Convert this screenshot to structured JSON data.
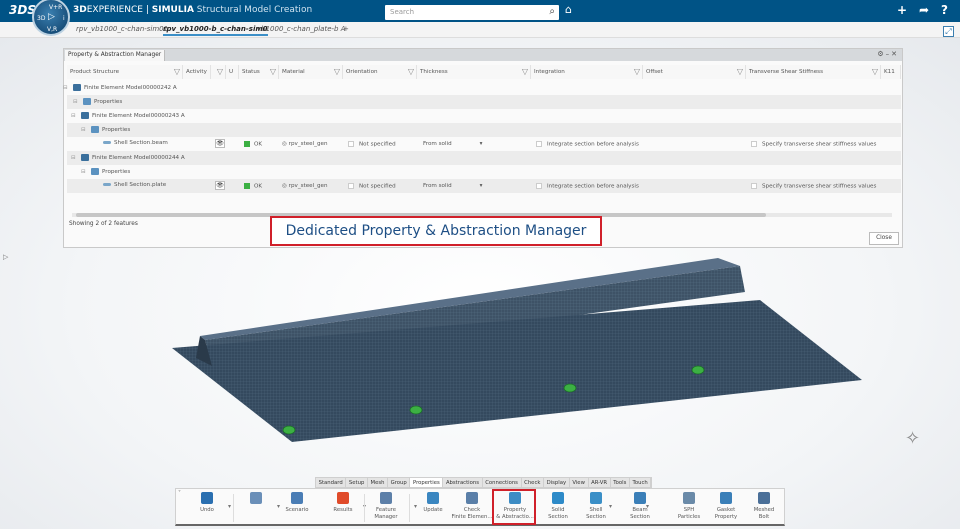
{
  "topbar": {
    "brand_bold": "3D",
    "brand_rest": "EXPERIENCE | ",
    "brand_app": "SIMULIA",
    "brand_title": " Structural Model Creation",
    "search_placeholder": "Search",
    "compass": {
      "top": "V+R",
      "left": "3D",
      "right": "i",
      "bottom": "V,R"
    }
  },
  "tabs": [
    {
      "label": "rpv_vb1000_c-chan-sim01"
    },
    {
      "label": "rpv_vb1000-b_c-chan-sim0",
      "active": true
    },
    {
      "label": "vb1000_c-chan_plate-b A"
    },
    {
      "label": "+"
    }
  ],
  "dialog": {
    "title": "Property & Abstraction Manager",
    "columns": [
      "Product Structure",
      "Activity",
      "",
      "U",
      "Status",
      "Material",
      "Orientation",
      "Thickness",
      "Integration",
      "Offset",
      "Transverse Shear Stiffness",
      "K11"
    ],
    "rows": [
      {
        "name": "Finite Element Model00000242 A",
        "type": "model"
      },
      {
        "name": "Properties",
        "type": "properties"
      },
      {
        "name": "Finite Element Model00000243 A",
        "type": "model"
      },
      {
        "name": "Properties",
        "type": "properties"
      },
      {
        "name": "Shell Section.beam",
        "type": "section",
        "status": "OK",
        "material": "rpv_steel_gen",
        "orientation": "Not specified",
        "thickness": "From solid",
        "integration": "Integrate section before analysis",
        "tss": "Specify transverse shear stiffness values"
      },
      {
        "name": "Finite Element Model00000244 A",
        "type": "model"
      },
      {
        "name": "Properties",
        "type": "properties"
      },
      {
        "name": "Shell Section.plate",
        "type": "section",
        "status": "OK",
        "material": "rpv_steel_gen",
        "orientation": "Not specified",
        "thickness": "From solid",
        "integration": "Integrate section before analysis",
        "tss": "Specify transverse shear stiffness values"
      }
    ],
    "showing": "Showing 2 of 2 features",
    "close": "Close"
  },
  "callout": "Dedicated Property & Abstraction Manager",
  "toolbar": {
    "tabs": [
      "Standard",
      "Setup",
      "Mesh",
      "Group",
      "Properties",
      "Abstractions",
      "Connections",
      "Check",
      "Display",
      "View",
      "AR-VR",
      "Tools",
      "Touch"
    ],
    "active_tab": "Properties",
    "tools": [
      {
        "l1": "Undo",
        "l2": ""
      },
      {
        "l1": "",
        "l2": ""
      },
      {
        "l1": "Scenario",
        "l2": ""
      },
      {
        "l1": "Results",
        "l2": ""
      },
      {
        "l1": "Feature",
        "l2": "Manager"
      },
      {
        "l1": "Update",
        "l2": ""
      },
      {
        "l1": "Check",
        "l2": "Finite Elemen..."
      },
      {
        "l1": "Property",
        "l2": "& Abstractio..."
      },
      {
        "l1": "Solid",
        "l2": "Section"
      },
      {
        "l1": "Shell",
        "l2": "Section"
      },
      {
        "l1": "Beam",
        "l2": "Section"
      },
      {
        "l1": "SPH",
        "l2": "Particles"
      },
      {
        "l1": "Gasket",
        "l2": "Property"
      },
      {
        "l1": "Meshed",
        "l2": "Bolt"
      }
    ]
  },
  "colors": {
    "topbar": "#005386",
    "highlight": "#d0202a",
    "callout_text": "#1e4f85",
    "mesh": "#34495e",
    "status_ok": "#3cb043"
  }
}
